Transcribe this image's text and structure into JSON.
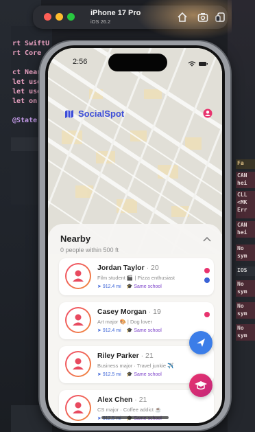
{
  "simulator": {
    "title": "iPhone 17 Pro",
    "subtitle": "iOS 26.2",
    "colors": {
      "close": "#fe5f57",
      "minimize": "#febc2e",
      "zoom": "#28c840"
    }
  },
  "code": {
    "lines": [
      {
        "text": "rt SwiftU",
        "color": "#e8a0c0"
      },
      {
        "text": "rt Core",
        "color": "#e8a0c0"
      },
      {
        "text": "ct Near",
        "color": "#e8a0c0"
      },
      {
        "text": "let use",
        "color": "#e8a0c0"
      },
      {
        "text": "let use",
        "color": "#e8a0c0"
      },
      {
        "text": "let on",
        "color": "#e8a0c0"
      },
      {
        "text": "@State",
        "color": "#c39ae8"
      }
    ],
    "sidebar": [
      {
        "text": "Fa",
        "kind": "head"
      },
      {
        "text": "CAN hei",
        "kind": "err"
      },
      {
        "text": "CLL <MK Err",
        "kind": "err"
      },
      {
        "text": "CAN hei",
        "kind": "err"
      },
      {
        "text": "No sym",
        "kind": "err"
      },
      {
        "text": "IOS",
        "kind": "dark"
      },
      {
        "text": "No sym",
        "kind": "err"
      },
      {
        "text": "No sym",
        "kind": "err"
      },
      {
        "text": "No sym",
        "kind": "err"
      }
    ]
  },
  "phone": {
    "status_time": "2:56",
    "app_name": "SocialSpot",
    "accent": "#3d4ed8",
    "sheet": {
      "title": "Nearby",
      "subtitle": "0 people within 500 ft"
    },
    "people": [
      {
        "name": "Jordan Taylor",
        "age": "· 20",
        "bio": "Film student 🎬 | Pizza enthusiast",
        "distance": "912.4 mi",
        "school": "Same school"
      },
      {
        "name": "Casey Morgan",
        "age": "· 19",
        "bio": "Art major 🎨 | Dog lover",
        "distance": "912.4 mi",
        "school": "Same school"
      },
      {
        "name": "Riley Parker",
        "age": "· 21",
        "bio": "Business major · Travel junkie ✈️",
        "distance": "912.5 mi",
        "school": "Same school"
      },
      {
        "name": "Alex Chen",
        "age": "· 21",
        "bio": "CS major · Coffee addict ☕",
        "distance": "912.5 mi",
        "school": "Same school"
      }
    ]
  }
}
